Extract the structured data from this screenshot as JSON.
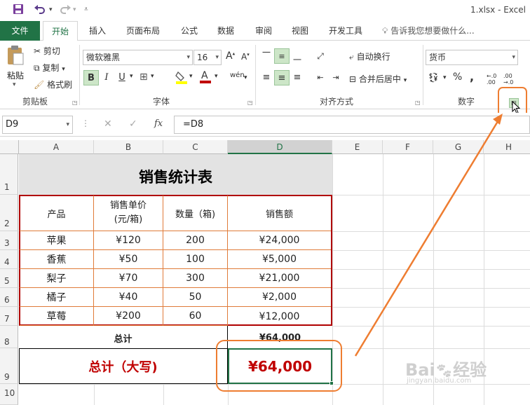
{
  "titlebar": {
    "file_title": "1.xlsx - Excel",
    "save_icon": "save-icon",
    "undo_icon": "undo-icon",
    "redo_icon": "redo-icon"
  },
  "tabs": {
    "file": "文件",
    "home": "开始",
    "insert": "插入",
    "page_layout": "页面布局",
    "formulas": "公式",
    "data": "数据",
    "review": "审阅",
    "view": "视图",
    "developer": "开发工具",
    "tell_me": "告诉我您想要做什么..."
  },
  "ribbon": {
    "clipboard": {
      "paste": "粘贴",
      "cut": "剪切",
      "copy": "复制",
      "format_painter": "格式刷",
      "group_label": "剪贴板"
    },
    "font": {
      "font_name": "微软雅黑",
      "font_size": "16",
      "bold": "B",
      "italic": "I",
      "underline": "U",
      "wen": "wén",
      "group_label": "字体"
    },
    "alignment": {
      "wrap_text": "自动换行",
      "merge_center": "合并后居中",
      "group_label": "对齐方式"
    },
    "number": {
      "format": "货币",
      "percent": "%",
      "comma": ",",
      "group_label": "数字"
    }
  },
  "formula_bar": {
    "name_box": "D9",
    "formula": "=D8",
    "fx": "fx"
  },
  "grid": {
    "columns": [
      "A",
      "B",
      "C",
      "D",
      "E",
      "F",
      "G",
      "H"
    ],
    "rows": [
      "1",
      "2",
      "3",
      "4",
      "5",
      "6",
      "7",
      "8",
      "9",
      "10"
    ],
    "title": "销售统计表",
    "headers": [
      "产品",
      "销售单价\n(元/箱)",
      "数量（箱)",
      "销售额"
    ],
    "header_unit_price_line1": "销售单价",
    "header_unit_price_line2": "(元/箱)",
    "data_rows": [
      {
        "product": "苹果",
        "price": "¥120",
        "qty": "200",
        "sales": "¥24,000"
      },
      {
        "product": "香蕉",
        "price": "¥50",
        "qty": "100",
        "sales": "¥5,000"
      },
      {
        "product": "梨子",
        "price": "¥70",
        "qty": "300",
        "sales": "¥21,000"
      },
      {
        "product": "橘子",
        "price": "¥40",
        "qty": "50",
        "sales": "¥2,000"
      },
      {
        "product": "草莓",
        "price": "¥200",
        "qty": "60",
        "sales": "¥12,000"
      }
    ],
    "total_label": "总计",
    "total_value": "¥64,000",
    "total_upper_label": "总计（大写)",
    "total_upper_value": "¥64,000"
  },
  "colors": {
    "excel_green": "#217346",
    "annotation_orange": "#ee7d31",
    "table_border_red": "#b00000",
    "text_red": "#c00000"
  }
}
